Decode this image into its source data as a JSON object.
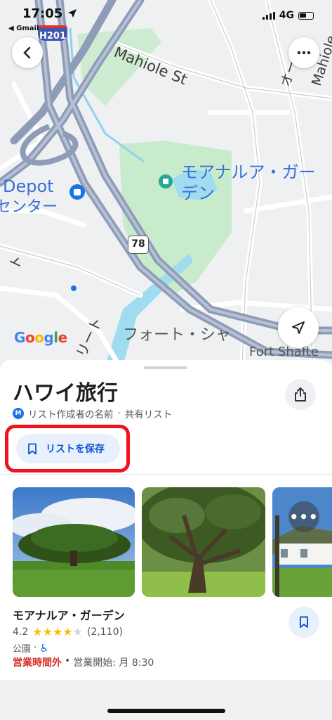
{
  "status_bar": {
    "time": "17:05",
    "back_app": "◀ Gmail",
    "network": "4G",
    "battery_level": "low"
  },
  "map": {
    "highway_shield": "H201",
    "route_number": "78",
    "street_mahiole": "Mahiole St",
    "street_vertical_right": "オーリ",
    "street_vertical_far_right": "Mahiole",
    "garden_label_line1": "モアナルア・ガー",
    "garden_label_line2": "デン",
    "depot_label_line1": "Depot",
    "depot_label_line2": "センター",
    "fort_label_jp": "フォート・シャ",
    "fort_label_en": "Fort Shafte",
    "vertical_left_1": "ト",
    "vertical_left_2": "リート",
    "google_logo": "Google"
  },
  "sheet": {
    "title": "ハワイ旅行",
    "avatar_letter": "M",
    "creator": "リスト作成者の名前",
    "separator": "·",
    "visibility": "共有リスト",
    "save_list_label": "リストを保存"
  },
  "place": {
    "name": "モアナルア・ガーデン",
    "rating": "4.2",
    "stars_filled": 4,
    "review_count": "(2,110)",
    "category": "公園",
    "category_separator": "·",
    "status": "営業時間外",
    "hours_separator": "•",
    "opening": "営業開始: 月 8:30",
    "more_label": "•••"
  },
  "colors": {
    "accent_blue": "#0b57d0",
    "highlight_red": "#f0131f",
    "closed_red": "#d93025",
    "star_yellow": "#fbbc04"
  }
}
